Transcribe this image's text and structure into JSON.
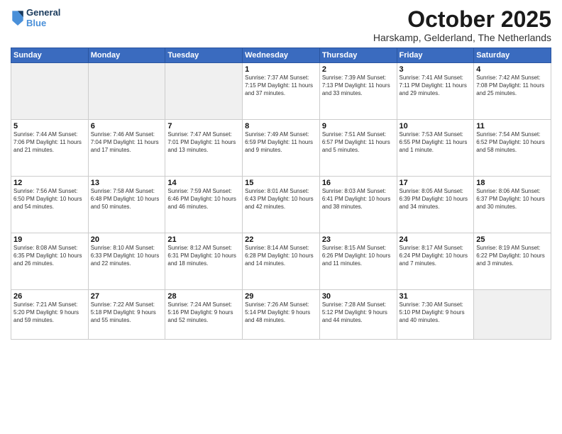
{
  "header": {
    "logo_line1": "General",
    "logo_line2": "Blue",
    "month": "October 2025",
    "location": "Harskamp, Gelderland, The Netherlands"
  },
  "days_of_week": [
    "Sunday",
    "Monday",
    "Tuesday",
    "Wednesday",
    "Thursday",
    "Friday",
    "Saturday"
  ],
  "weeks": [
    [
      {
        "day": "",
        "info": ""
      },
      {
        "day": "",
        "info": ""
      },
      {
        "day": "",
        "info": ""
      },
      {
        "day": "1",
        "info": "Sunrise: 7:37 AM\nSunset: 7:15 PM\nDaylight: 11 hours\nand 37 minutes."
      },
      {
        "day": "2",
        "info": "Sunrise: 7:39 AM\nSunset: 7:13 PM\nDaylight: 11 hours\nand 33 minutes."
      },
      {
        "day": "3",
        "info": "Sunrise: 7:41 AM\nSunset: 7:11 PM\nDaylight: 11 hours\nand 29 minutes."
      },
      {
        "day": "4",
        "info": "Sunrise: 7:42 AM\nSunset: 7:08 PM\nDaylight: 11 hours\nand 25 minutes."
      }
    ],
    [
      {
        "day": "5",
        "info": "Sunrise: 7:44 AM\nSunset: 7:06 PM\nDaylight: 11 hours\nand 21 minutes."
      },
      {
        "day": "6",
        "info": "Sunrise: 7:46 AM\nSunset: 7:04 PM\nDaylight: 11 hours\nand 17 minutes."
      },
      {
        "day": "7",
        "info": "Sunrise: 7:47 AM\nSunset: 7:01 PM\nDaylight: 11 hours\nand 13 minutes."
      },
      {
        "day": "8",
        "info": "Sunrise: 7:49 AM\nSunset: 6:59 PM\nDaylight: 11 hours\nand 9 minutes."
      },
      {
        "day": "9",
        "info": "Sunrise: 7:51 AM\nSunset: 6:57 PM\nDaylight: 11 hours\nand 5 minutes."
      },
      {
        "day": "10",
        "info": "Sunrise: 7:53 AM\nSunset: 6:55 PM\nDaylight: 11 hours\nand 1 minute."
      },
      {
        "day": "11",
        "info": "Sunrise: 7:54 AM\nSunset: 6:52 PM\nDaylight: 10 hours\nand 58 minutes."
      }
    ],
    [
      {
        "day": "12",
        "info": "Sunrise: 7:56 AM\nSunset: 6:50 PM\nDaylight: 10 hours\nand 54 minutes."
      },
      {
        "day": "13",
        "info": "Sunrise: 7:58 AM\nSunset: 6:48 PM\nDaylight: 10 hours\nand 50 minutes."
      },
      {
        "day": "14",
        "info": "Sunrise: 7:59 AM\nSunset: 6:46 PM\nDaylight: 10 hours\nand 46 minutes."
      },
      {
        "day": "15",
        "info": "Sunrise: 8:01 AM\nSunset: 6:43 PM\nDaylight: 10 hours\nand 42 minutes."
      },
      {
        "day": "16",
        "info": "Sunrise: 8:03 AM\nSunset: 6:41 PM\nDaylight: 10 hours\nand 38 minutes."
      },
      {
        "day": "17",
        "info": "Sunrise: 8:05 AM\nSunset: 6:39 PM\nDaylight: 10 hours\nand 34 minutes."
      },
      {
        "day": "18",
        "info": "Sunrise: 8:06 AM\nSunset: 6:37 PM\nDaylight: 10 hours\nand 30 minutes."
      }
    ],
    [
      {
        "day": "19",
        "info": "Sunrise: 8:08 AM\nSunset: 6:35 PM\nDaylight: 10 hours\nand 26 minutes."
      },
      {
        "day": "20",
        "info": "Sunrise: 8:10 AM\nSunset: 6:33 PM\nDaylight: 10 hours\nand 22 minutes."
      },
      {
        "day": "21",
        "info": "Sunrise: 8:12 AM\nSunset: 6:31 PM\nDaylight: 10 hours\nand 18 minutes."
      },
      {
        "day": "22",
        "info": "Sunrise: 8:14 AM\nSunset: 6:28 PM\nDaylight: 10 hours\nand 14 minutes."
      },
      {
        "day": "23",
        "info": "Sunrise: 8:15 AM\nSunset: 6:26 PM\nDaylight: 10 hours\nand 11 minutes."
      },
      {
        "day": "24",
        "info": "Sunrise: 8:17 AM\nSunset: 6:24 PM\nDaylight: 10 hours\nand 7 minutes."
      },
      {
        "day": "25",
        "info": "Sunrise: 8:19 AM\nSunset: 6:22 PM\nDaylight: 10 hours\nand 3 minutes."
      }
    ],
    [
      {
        "day": "26",
        "info": "Sunrise: 7:21 AM\nSunset: 5:20 PM\nDaylight: 9 hours\nand 59 minutes."
      },
      {
        "day": "27",
        "info": "Sunrise: 7:22 AM\nSunset: 5:18 PM\nDaylight: 9 hours\nand 55 minutes."
      },
      {
        "day": "28",
        "info": "Sunrise: 7:24 AM\nSunset: 5:16 PM\nDaylight: 9 hours\nand 52 minutes."
      },
      {
        "day": "29",
        "info": "Sunrise: 7:26 AM\nSunset: 5:14 PM\nDaylight: 9 hours\nand 48 minutes."
      },
      {
        "day": "30",
        "info": "Sunrise: 7:28 AM\nSunset: 5:12 PM\nDaylight: 9 hours\nand 44 minutes."
      },
      {
        "day": "31",
        "info": "Sunrise: 7:30 AM\nSunset: 5:10 PM\nDaylight: 9 hours\nand 40 minutes."
      },
      {
        "day": "",
        "info": ""
      }
    ]
  ]
}
